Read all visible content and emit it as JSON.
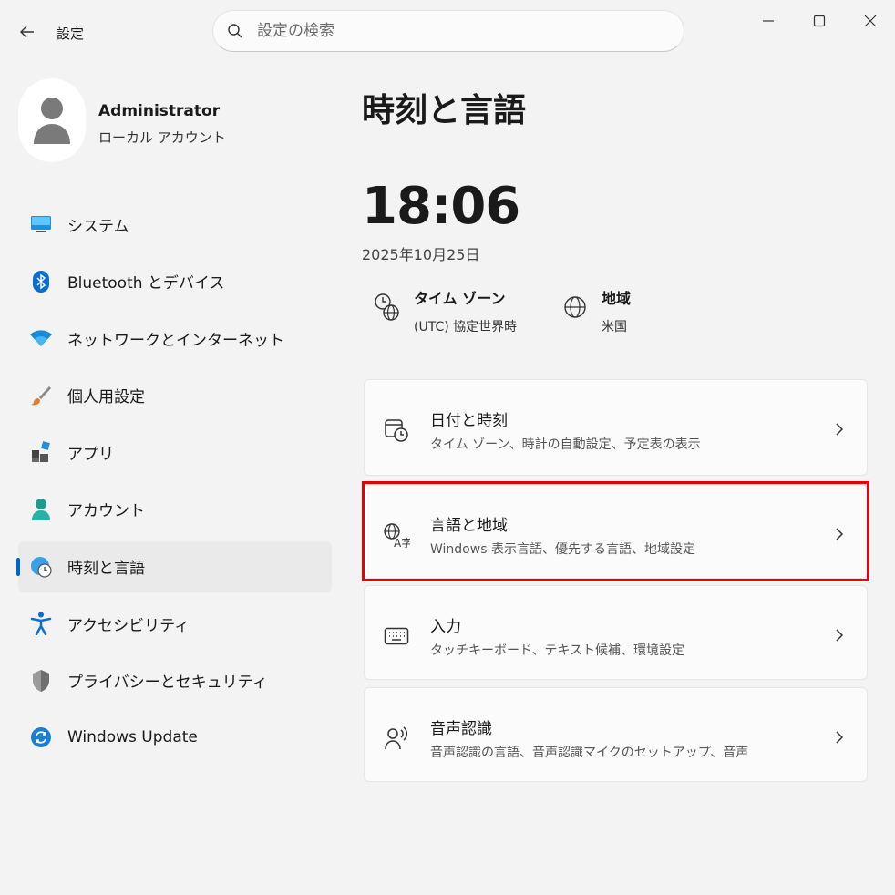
{
  "window": {
    "title": "設定",
    "search_placeholder": "設定の検索"
  },
  "profile": {
    "name": "Administrator",
    "type": "ローカル アカウント"
  },
  "sidebar": {
    "items": [
      {
        "label": "システム",
        "icon": "system-icon"
      },
      {
        "label": "Bluetooth とデバイス",
        "icon": "bluetooth-icon"
      },
      {
        "label": "ネットワークとインターネット",
        "icon": "wifi-icon"
      },
      {
        "label": "個人用設定",
        "icon": "brush-icon"
      },
      {
        "label": "アプリ",
        "icon": "apps-icon"
      },
      {
        "label": "アカウント",
        "icon": "account-icon"
      },
      {
        "label": "時刻と言語",
        "icon": "time-language-icon",
        "active": true
      },
      {
        "label": "アクセシビリティ",
        "icon": "accessibility-icon"
      },
      {
        "label": "プライバシーとセキュリティ",
        "icon": "shield-icon"
      },
      {
        "label": "Windows Update",
        "icon": "update-icon"
      }
    ]
  },
  "main": {
    "title": "時刻と言語",
    "time": "18:06",
    "date": "2025年10月25日",
    "timezone": {
      "label": "タイム ゾーン",
      "value": "(UTC) 協定世界時"
    },
    "region": {
      "label": "地域",
      "value": "米国"
    },
    "cards": [
      {
        "title": "日付と時刻",
        "subtitle": "タイム ゾーン、時計の自動設定、予定表の表示",
        "icon": "calendar-clock-icon"
      },
      {
        "title": "言語と地域",
        "subtitle": "Windows 表示言語、優先する言語、地域設定",
        "icon": "language-icon"
      },
      {
        "title": "入力",
        "subtitle": "タッチキーボード、テキスト候補、環境設定",
        "icon": "keyboard-icon"
      },
      {
        "title": "音声認識",
        "subtitle": "音声認識の言語、音声認識マイクのセットアップ、音声",
        "icon": "speech-icon"
      }
    ]
  },
  "colors": {
    "accent": "#0067c0",
    "highlight": "#e60000"
  }
}
